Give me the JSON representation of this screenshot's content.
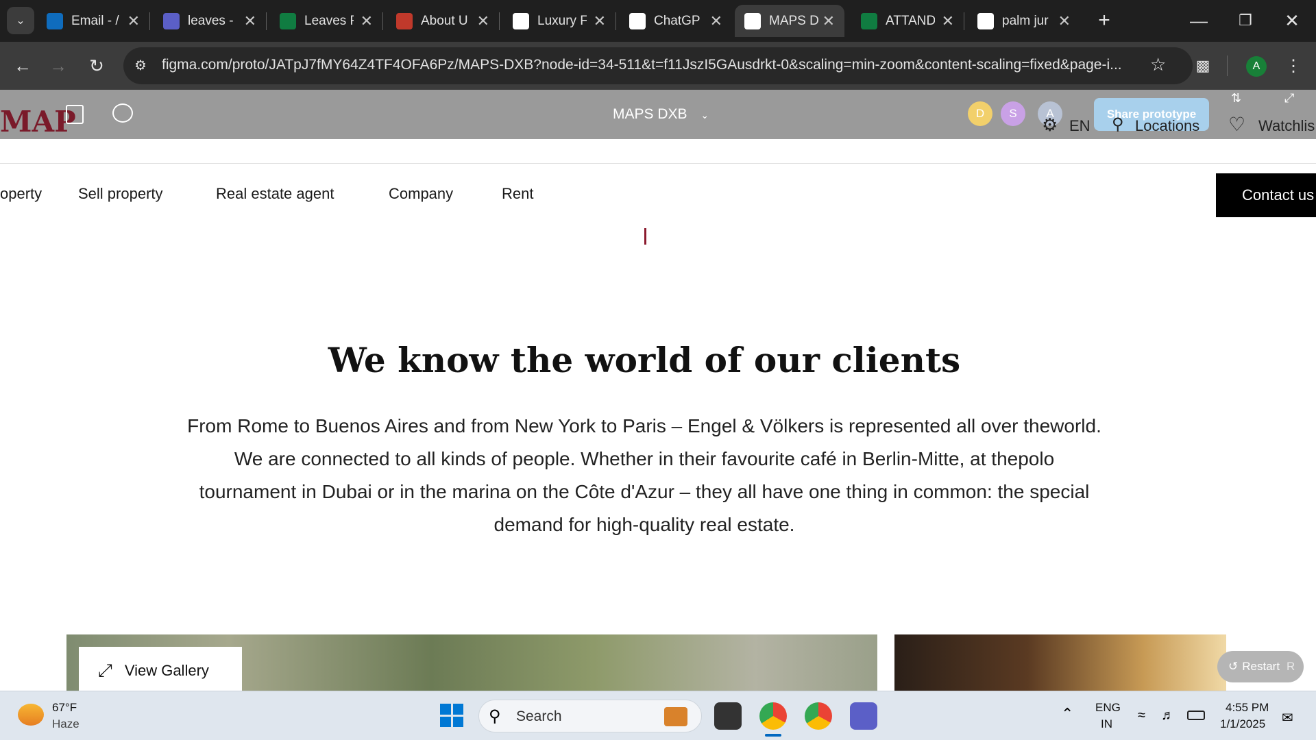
{
  "browser": {
    "tabs": [
      {
        "title": "Email - /",
        "icon": "outlook-icon",
        "color": "#0f6cbd"
      },
      {
        "title": "leaves -",
        "icon": "copilot-icon",
        "color": "#5b5fc7"
      },
      {
        "title": "Leaves F",
        "icon": "excel-icon",
        "color": "#107c41"
      },
      {
        "title": "About U",
        "icon": "site-icon",
        "color": "#c0392b"
      },
      {
        "title": "Luxury F",
        "icon": "ev-icon",
        "color": "#ffffff"
      },
      {
        "title": "ChatGP",
        "icon": "chatgpt-icon",
        "color": "#ffffff"
      },
      {
        "title": "MAPS D",
        "icon": "figma-play-icon",
        "color": "#ffffff",
        "active": true
      },
      {
        "title": "ATTAND",
        "icon": "excel-icon",
        "color": "#107c41"
      },
      {
        "title": "palm jur",
        "icon": "google-icon",
        "color": "#ffffff"
      }
    ],
    "url": "figma.com/proto/JATpJ7fMY64Z4TF4OFA6Pz/MAPS-DXB?node-id=34-511&t=f11JszI5GAusdrkt-0&scaling=min-zoom&content-scaling=fixed&page-i...",
    "profile_initial": "A"
  },
  "figma": {
    "file_name": "MAPS DXB",
    "presence": [
      "D",
      "S",
      "A"
    ],
    "presence_colors": [
      "#f2d06b",
      "#c9a1e6",
      "#b8c2d4"
    ],
    "share_label": "Share prototype",
    "restart_label": "Restart",
    "restart_key": "R"
  },
  "site": {
    "logo_text": "MAP",
    "language": "EN",
    "locations_label": "Locations",
    "watchlist_label": "Watchlis",
    "nav": [
      "operty",
      "Sell property",
      "Real estate agent",
      "Company",
      "Rent"
    ],
    "contact_label": "Contact us",
    "heading": "We know the world of our clients",
    "body": "From Rome to Buenos Aires and from New York to Paris – Engel & Völkers is represented all over theworld. We are connected to all kinds of people. Whether in their favourite café in Berlin-Mitte, at thepolo tournament in Dubai or in the marina on the Côte d'Azur – they all have one thing in common: the special demand for high-quality real estate.",
    "gallery_label": "View Gallery"
  },
  "taskbar": {
    "weather_temp": "67°F",
    "weather_desc": "Haze",
    "search_placeholder": "Search",
    "lang_line1": "ENG",
    "lang_line2": "IN",
    "time": "4:55 PM",
    "date": "1/1/2025"
  }
}
